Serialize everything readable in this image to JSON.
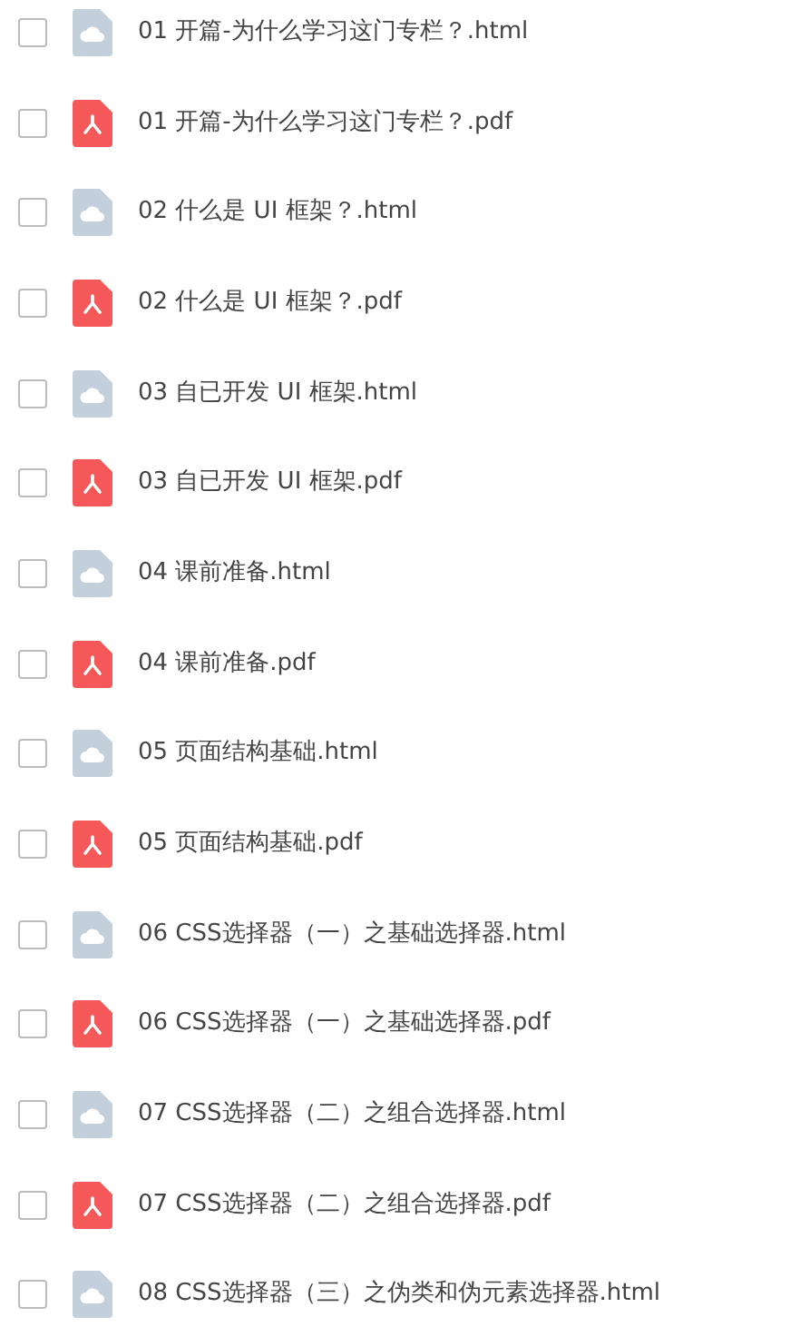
{
  "files": [
    {
      "kind": "html",
      "name": "01 开篇-为什么学习这门专栏？.html",
      "checked": false
    },
    {
      "kind": "pdf",
      "name": "01 开篇-为什么学习这门专栏？.pdf",
      "checked": false
    },
    {
      "kind": "html",
      "name": "02 什么是 UI 框架？.html",
      "checked": false
    },
    {
      "kind": "pdf",
      "name": "02 什么是 UI 框架？.pdf",
      "checked": false
    },
    {
      "kind": "html",
      "name": "03 自已开发 UI 框架.html",
      "checked": false
    },
    {
      "kind": "pdf",
      "name": "03 自已开发 UI 框架.pdf",
      "checked": false
    },
    {
      "kind": "html",
      "name": "04 课前准备.html",
      "checked": false
    },
    {
      "kind": "pdf",
      "name": "04 课前准备.pdf",
      "checked": false
    },
    {
      "kind": "html",
      "name": "05 页面结构基础.html",
      "checked": false
    },
    {
      "kind": "pdf",
      "name": "05 页面结构基础.pdf",
      "checked": false
    },
    {
      "kind": "html",
      "name": "06 CSS选择器（一）之基础选择器.html",
      "checked": false
    },
    {
      "kind": "pdf",
      "name": "06 CSS选择器（一）之基础选择器.pdf",
      "checked": false
    },
    {
      "kind": "html",
      "name": "07 CSS选择器（二）之组合选择器.html",
      "checked": false
    },
    {
      "kind": "pdf",
      "name": "07 CSS选择器（二）之组合选择器.pdf",
      "checked": false
    },
    {
      "kind": "html",
      "name": "08 CSS选择器（三）之伪类和伪元素选择器.html",
      "checked": false
    }
  ]
}
